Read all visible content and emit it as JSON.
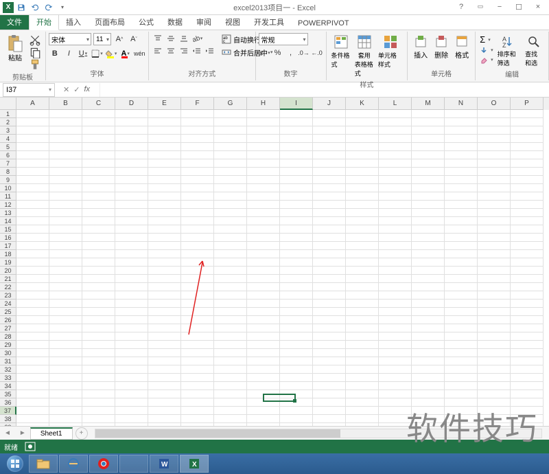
{
  "app_title": "excel2013项目一 - Excel",
  "tabs": {
    "file": "文件",
    "items": [
      "开始",
      "插入",
      "页面布局",
      "公式",
      "数据",
      "审阅",
      "视图",
      "开发工具",
      "POWERPIVOT"
    ],
    "active": 0
  },
  "ribbon": {
    "clipboard": {
      "paste": "粘贴",
      "label": "剪贴板"
    },
    "font": {
      "name": "宋体",
      "size": "11",
      "bold": "B",
      "italic": "I",
      "underline": "U",
      "label": "字体"
    },
    "alignment": {
      "wrap": "自动换行",
      "merge": "合并后居中",
      "label": "对齐方式"
    },
    "number": {
      "format": "常规",
      "label": "数字"
    },
    "styles": {
      "cond": "条件格式",
      "table": "套用",
      "table2": "表格格式",
      "cell": "单元格样式",
      "label": "样式"
    },
    "cells": {
      "insert": "插入",
      "delete": "删除",
      "format": "格式",
      "label": "单元格"
    },
    "editing": {
      "sort": "排序和筛选",
      "find": "查找和选",
      "label": "编辑"
    }
  },
  "name_box": "I37",
  "columns": [
    "A",
    "B",
    "C",
    "D",
    "E",
    "F",
    "G",
    "H",
    "I",
    "J",
    "K",
    "L",
    "M",
    "N",
    "O",
    "P"
  ],
  "selected_col": 8,
  "row_count": 39,
  "selected_row": 37,
  "sheet_tab": "Sheet1",
  "status": "就绪",
  "watermark": "软件技巧",
  "taskbar_icons": [
    "start",
    "explorer",
    "ie",
    "chrome",
    "blank",
    "word",
    "excel"
  ]
}
